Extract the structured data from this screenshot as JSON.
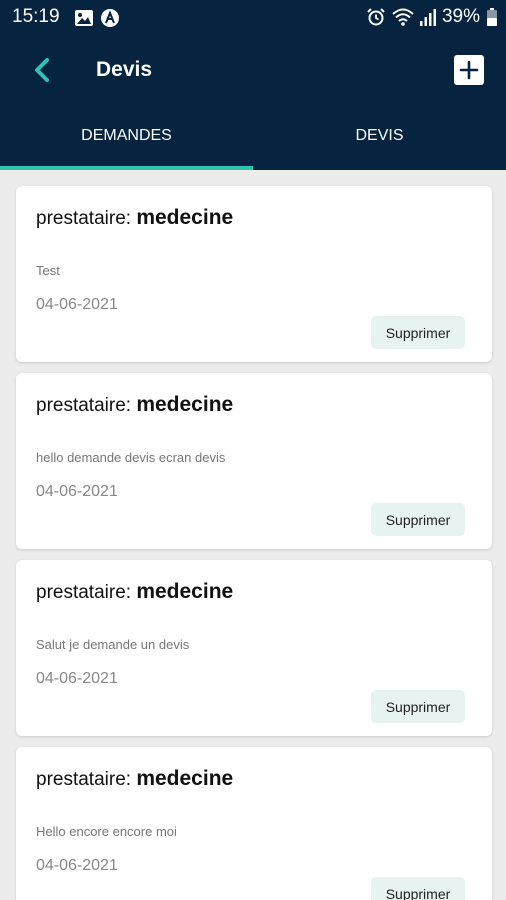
{
  "status_bar": {
    "time": "15:19",
    "battery": "39%"
  },
  "header": {
    "title": "Devis"
  },
  "tabs": [
    {
      "label": "DEMANDES",
      "active": true
    },
    {
      "label": "DEVIS",
      "active": false
    }
  ],
  "requests": [
    {
      "provider_prefix": "prestataire:",
      "provider": "medecine",
      "description": "Test",
      "date": "04-06-2021",
      "delete_label": "Supprimer"
    },
    {
      "provider_prefix": "prestataire:",
      "provider": "medecine",
      "description": "hello demande devis ecran devis",
      "date": "04-06-2021",
      "delete_label": "Supprimer"
    },
    {
      "provider_prefix": "prestataire:",
      "provider": "medecine",
      "description": "Salut je demande un devis",
      "date": "04-06-2021",
      "delete_label": "Supprimer"
    },
    {
      "provider_prefix": "prestataire:",
      "provider": "medecine",
      "description": "Hello encore encore moi",
      "date": "04-06-2021",
      "delete_label": "Supprimer"
    }
  ],
  "colors": {
    "header_bg": "#062340",
    "accent": "#2fc4b2",
    "delete_button_bg": "#e6f3f1"
  },
  "icons": {
    "back": "chevron-left-icon",
    "add": "plus-icon"
  }
}
